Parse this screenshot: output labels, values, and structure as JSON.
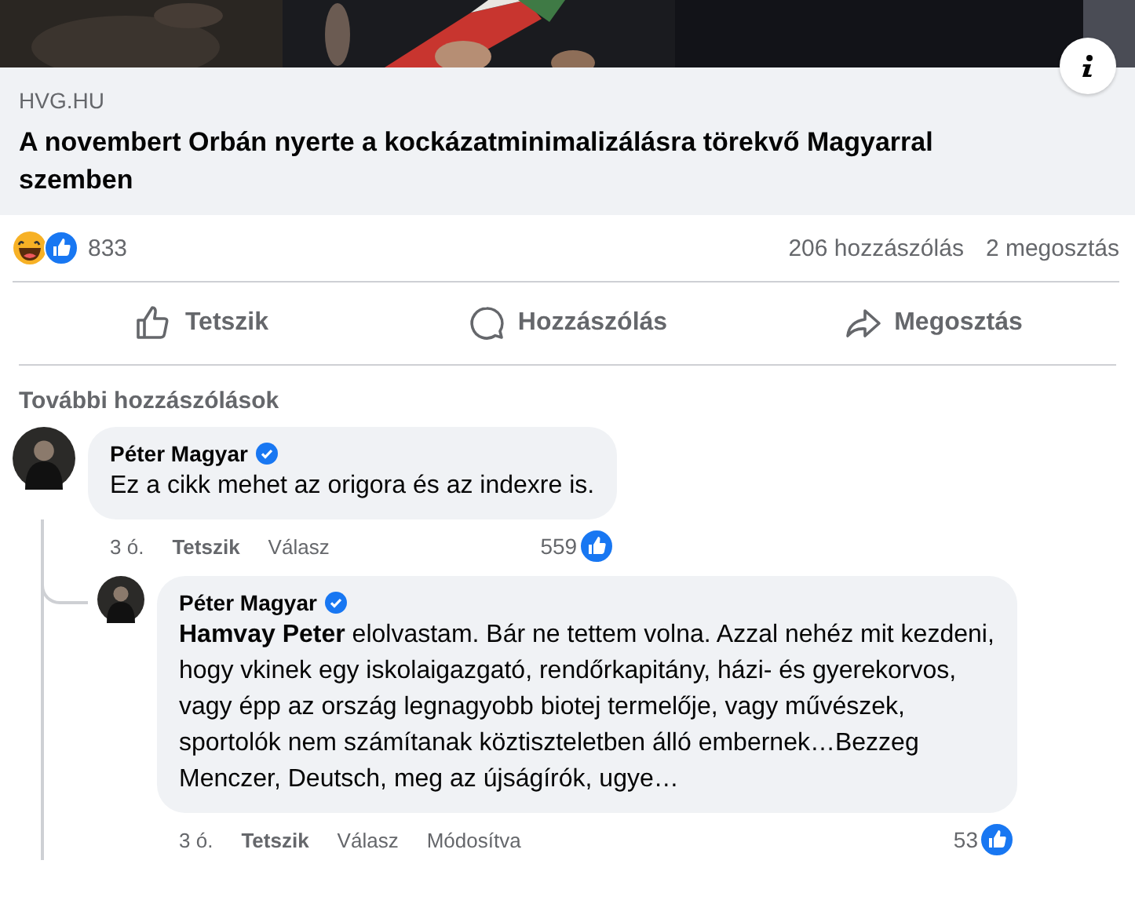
{
  "preview": {
    "kind": "picture",
    "source": "HVG.HU",
    "title": "A novembert Orbán nyerte a kockázatminimalizálásra törekvő Magyarral szemben"
  },
  "stats": {
    "reactions": [
      {
        "kind": "haha"
      },
      {
        "kind": "like"
      }
    ],
    "count": "833",
    "comments": "206 hozzászólás",
    "shares": "2 megosztás"
  },
  "actions": [
    {
      "kind": "like",
      "label": "Tetszik"
    },
    {
      "kind": "comment",
      "label": "Hozzászólás"
    },
    {
      "kind": "share",
      "label": "Megosztás"
    }
  ],
  "more_comments": "További hozzászólások",
  "comments": [
    {
      "author": "Péter Magyar",
      "verified": true,
      "text": "Ez a cikk mehet az origora és az indexre is.",
      "time": "3 ó.",
      "like": "Tetszik",
      "reply": "Válasz",
      "likes": "559",
      "children": [
        {
          "author": "Péter Magyar",
          "verified": true,
          "text": "**Hamvay Peter** elolvastam. Bár ne tettem volna. Azzal nehéz mit kezdeni, hogy vkinek egy iskolaigazgató, rendőrkapitány, házi- és gyerekorvos, vagy épp az ország legnagyobb biotej termelője, vagy művészek, sportolók nem számítanak köztiszteletben álló embernek…Bezzeg Menczer, Deutsch, meg az újságírók, ugye…",
          "time": "3 ó.",
          "like": "Tetszik",
          "reply": "Válasz",
          "edited": "Módosítva",
          "likes": "53"
        }
      ]
    }
  ]
}
